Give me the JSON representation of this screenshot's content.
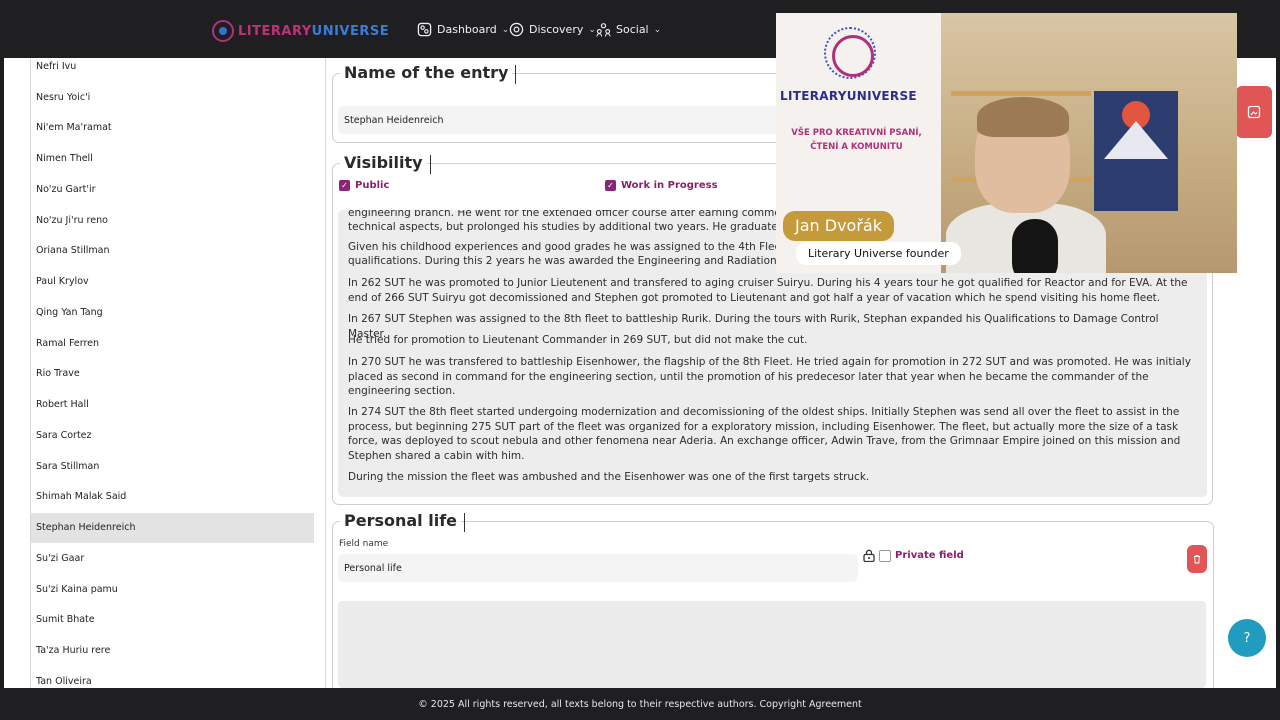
{
  "app": {
    "logo_part1": "LITERARY",
    "logo_part2": "UNIVERSE",
    "nav": [
      {
        "label": "Dashboard"
      },
      {
        "label": "Discovery"
      },
      {
        "label": "Social"
      }
    ]
  },
  "sidebar": {
    "items": [
      "Nefri Ivu",
      "Nesru Yoic'i",
      "Ni'em Ma'ramat",
      "Nimen Thell",
      "No'zu Gart'ir",
      "No'zu Ji'ru reno",
      "Oriana Stillman",
      "Paul Krylov",
      "Qing Yan Tang",
      "Ramal Ferren",
      "Rio Trave",
      "Robert Hall",
      "Sara Cortez",
      "Sara Stillman",
      "Shimah Malak Said",
      "Stephan Heidenreich",
      "Su'zi Gaar",
      "Su'zi Kaina pamu",
      "Sumit Bhate",
      "Ta'za Huriu rere",
      "Tan Oliveira"
    ],
    "active_index": 15
  },
  "entry": {
    "name_title": "Name of the entry",
    "name_value": "Stephan Heidenreich",
    "visibility_title": "Visibility",
    "public_label": "Public",
    "wip_label": "Work in Progress"
  },
  "biography": {
    "paragraphs": [
      "engineering branch. He went for the extended officer course after earning comme",
      "technical aspects, but prolonged his studies by additional two years. He graduatec",
      "Given his childhood experiences and good grades he was assigned to the 4th Fleet,",
      "qualifications. During this 2 years he was awarded the Engineering and Radiation S",
      "In 262 SUT he was promoted to Junior Lieutenent and transfered to aging cruiser Suiryu. During his 4 years tour he got qualified for Reactor and for EVA. At the end of 266 SUT Suiryu got decomissioned and Stephen got promoted to Lieutenant and got half a year of vacation which he spend visiting his home fleet.",
      "In 267 SUT Stephen was assigned to the 8th fleet to battleship Rurik. During the tours with Rurik, Stephan expanded his Qualifications to Damage Control Master.",
      "He tried for promotion to Lieutenant Commander in 269 SUT, but did not make the cut.",
      "In 270 SUT he was transfered to battleship Eisenhower, the flagship of the 8th Fleet. He tried again for promotion in 272 SUT and was promoted. He was initialy placed as second in command for the engineering section, until the promotion of his predecesor later that year when he became the commander of the engineering section.",
      "In 274 SUT the 8th fleet started undergoing modernization and decomissioning of the oldest ships. Initially Stephen was send all over the fleet to assist in the process, but beginning 275 SUT part of the fleet was organized for a exploratory mission, including Eisenhower. The fleet, but actually more the size of a task force, was deployed to scout nebula and other fenomena near Aderia. An exchange officer, Adwin Trave, from the Grimnaar Empire joined on this mission and Stephen shared a cabin with him.",
      "During the mission the fleet was ambushed and the Eisenhower was one of the first targets struck."
    ]
  },
  "personal": {
    "title": "Personal life",
    "field_name_label": "Field name",
    "field_name_value": "Personal life",
    "private_label": "Private field"
  },
  "video": {
    "brand": "LITERARYUNIVERSE",
    "tagline": "VŠE PRO KREATIVNÍ PSANÍ, ČTENÍ A KOMUNITU",
    "name": "Jan Dvořák",
    "role": "Literary Universe founder"
  },
  "help_label": "?",
  "footer": {
    "text": "© 2025 All rights reserved, all texts belong to their respective authors. Copyright Agreement"
  }
}
